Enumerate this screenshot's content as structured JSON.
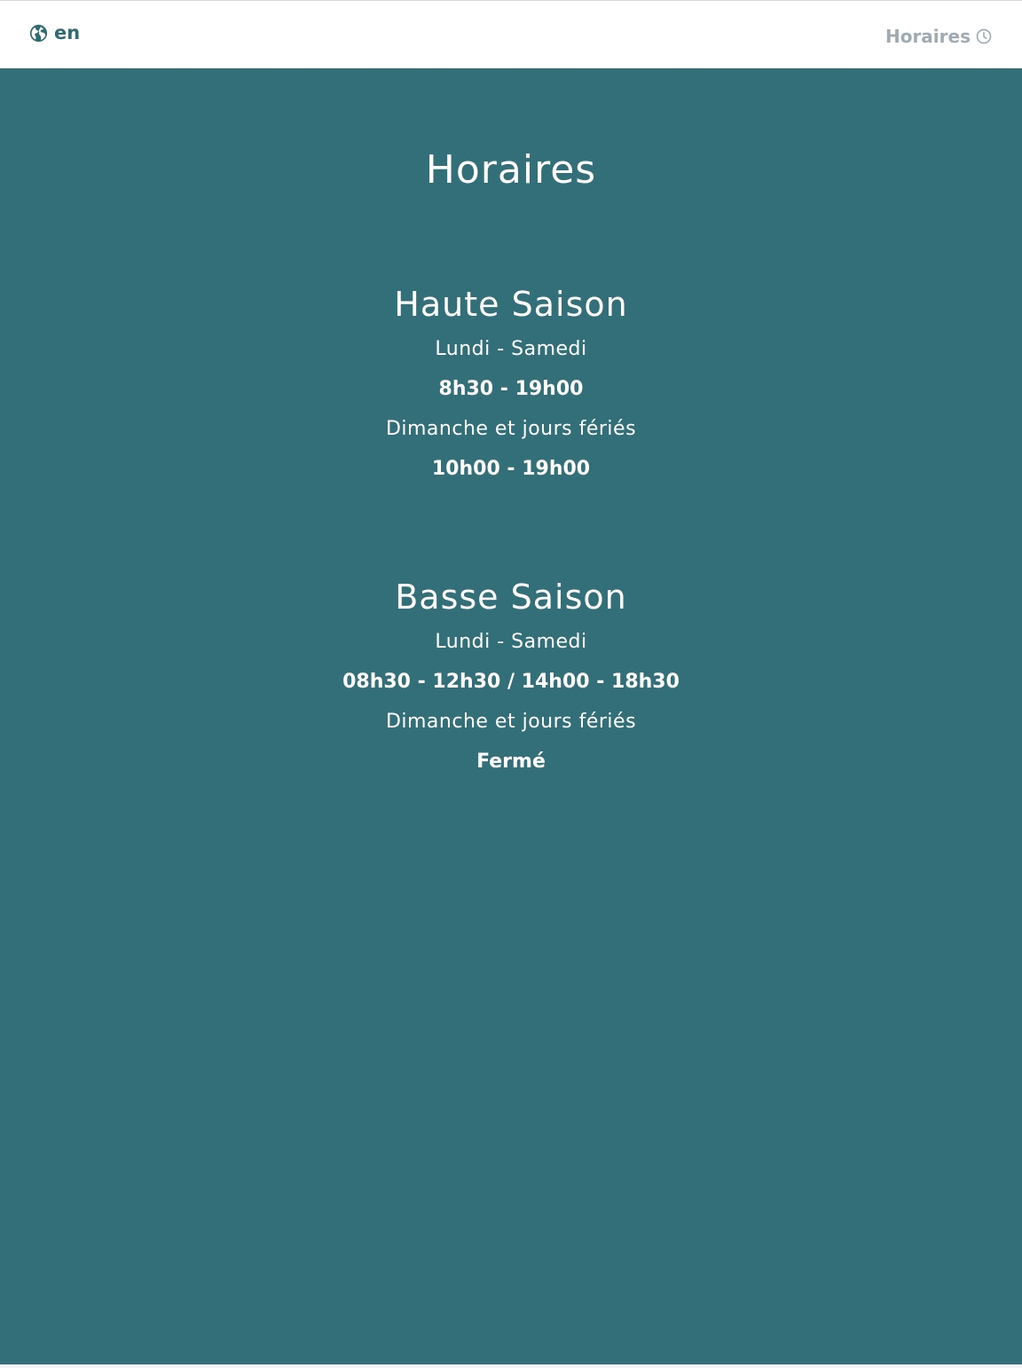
{
  "navbar": {
    "language_label": "en",
    "language_icon": "globe-icon",
    "hours_link_label": "Horaires",
    "hours_link_icon": "clock-icon",
    "brand_color": "#2f6b73",
    "link_color": "#9fabb3"
  },
  "page": {
    "title": "Horaires",
    "background_color": "#336f79"
  },
  "seasons": [
    {
      "title": "Haute Saison",
      "schedule": [
        {
          "days": "Lundi - Samedi",
          "hours": "8h30 - 19h00"
        },
        {
          "days": "Dimanche et jours fériés",
          "hours": "10h00 - 19h00"
        }
      ]
    },
    {
      "title": "Basse Saison",
      "schedule": [
        {
          "days": "Lundi - Samedi",
          "hours": "08h30 - 12h30 / 14h00 - 18h30"
        },
        {
          "days": "Dimanche et jours fériés",
          "hours": "Fermé"
        }
      ]
    }
  ]
}
